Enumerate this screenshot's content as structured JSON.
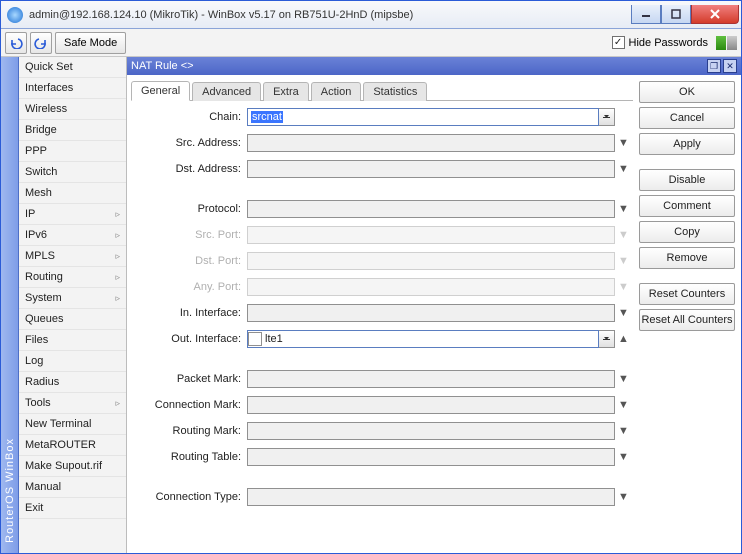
{
  "title": "admin@192.168.124.10 (MikroTik) - WinBox v5.17 on RB751U-2HnD (mipsbe)",
  "toolbar": {
    "safe_mode": "Safe Mode",
    "hide_passwords": "Hide Passwords"
  },
  "vtab": "RouterOS WinBox",
  "sidebar": [
    {
      "label": "Quick Set",
      "sub": false
    },
    {
      "label": "Interfaces",
      "sub": false
    },
    {
      "label": "Wireless",
      "sub": false
    },
    {
      "label": "Bridge",
      "sub": false
    },
    {
      "label": "PPP",
      "sub": false
    },
    {
      "label": "Switch",
      "sub": false
    },
    {
      "label": "Mesh",
      "sub": false
    },
    {
      "label": "IP",
      "sub": true
    },
    {
      "label": "IPv6",
      "sub": true
    },
    {
      "label": "MPLS",
      "sub": true
    },
    {
      "label": "Routing",
      "sub": true
    },
    {
      "label": "System",
      "sub": true
    },
    {
      "label": "Queues",
      "sub": false
    },
    {
      "label": "Files",
      "sub": false
    },
    {
      "label": "Log",
      "sub": false
    },
    {
      "label": "Radius",
      "sub": false
    },
    {
      "label": "Tools",
      "sub": true
    },
    {
      "label": "New Terminal",
      "sub": false
    },
    {
      "label": "MetaROUTER",
      "sub": false
    },
    {
      "label": "Make Supout.rif",
      "sub": false
    },
    {
      "label": "Manual",
      "sub": false
    },
    {
      "label": "Exit",
      "sub": false
    }
  ],
  "sub": {
    "title": "NAT Rule <>",
    "tabs": [
      "General",
      "Advanced",
      "Extra",
      "Action",
      "Statistics"
    ],
    "active_tab": 0,
    "labels": {
      "chain": "Chain:",
      "src_addr": "Src. Address:",
      "dst_addr": "Dst. Address:",
      "protocol": "Protocol:",
      "src_port": "Src. Port:",
      "dst_port": "Dst. Port:",
      "any_port": "Any. Port:",
      "in_if": "In. Interface:",
      "out_if": "Out. Interface:",
      "pkt_mark": "Packet Mark:",
      "conn_mark": "Connection Mark:",
      "rt_mark": "Routing Mark:",
      "rt_table": "Routing Table:",
      "conn_type": "Connection Type:"
    },
    "values": {
      "chain": "srcnat",
      "out_if": "lte1"
    },
    "buttons": {
      "ok": "OK",
      "cancel": "Cancel",
      "apply": "Apply",
      "disable": "Disable",
      "comment": "Comment",
      "copy": "Copy",
      "remove": "Remove",
      "reset": "Reset Counters",
      "reset_all": "Reset All Counters"
    }
  }
}
